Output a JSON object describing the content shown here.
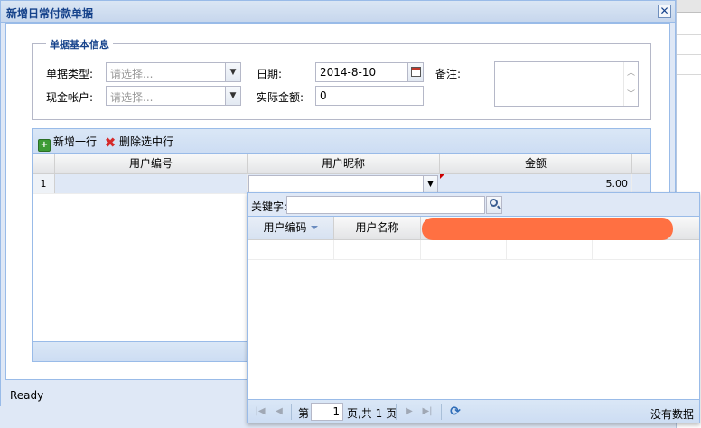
{
  "window": {
    "title": "新增日常付款单据",
    "close_label": "✕",
    "status": "Ready"
  },
  "form": {
    "legend": "单据基本信息",
    "doc_type_label": "单据类型:",
    "doc_type_placeholder": "请选择...",
    "cash_account_label": "现金帐户:",
    "cash_account_placeholder": "请选择...",
    "date_label": "日期:",
    "date_value": "2014-8-10",
    "actual_amount_label": "实际金额:",
    "actual_amount_value": "0",
    "remark_label": "备注:"
  },
  "grid": {
    "toolbar": {
      "add_row": "新增一行",
      "delete_rows": "删除选中行"
    },
    "columns": [
      "用户编号",
      "用户昵称",
      "金额"
    ],
    "rows": [
      {
        "row_number": "1",
        "user_id": "",
        "nickname": "",
        "amount": "5.00"
      }
    ]
  },
  "popup": {
    "keyword_label": "关键字:",
    "keyword_value": "",
    "columns": [
      "用户编码",
      "用户名称"
    ],
    "pager": {
      "page_label": "第",
      "page_value": "1",
      "page_suffix": "页,共 1 页",
      "empty_text": "没有数据"
    }
  },
  "colors": {
    "header_blue": "#15428b",
    "panel_bg": "#dfe8f6",
    "border": "#99bbe8",
    "redaction": "#ff7042"
  }
}
